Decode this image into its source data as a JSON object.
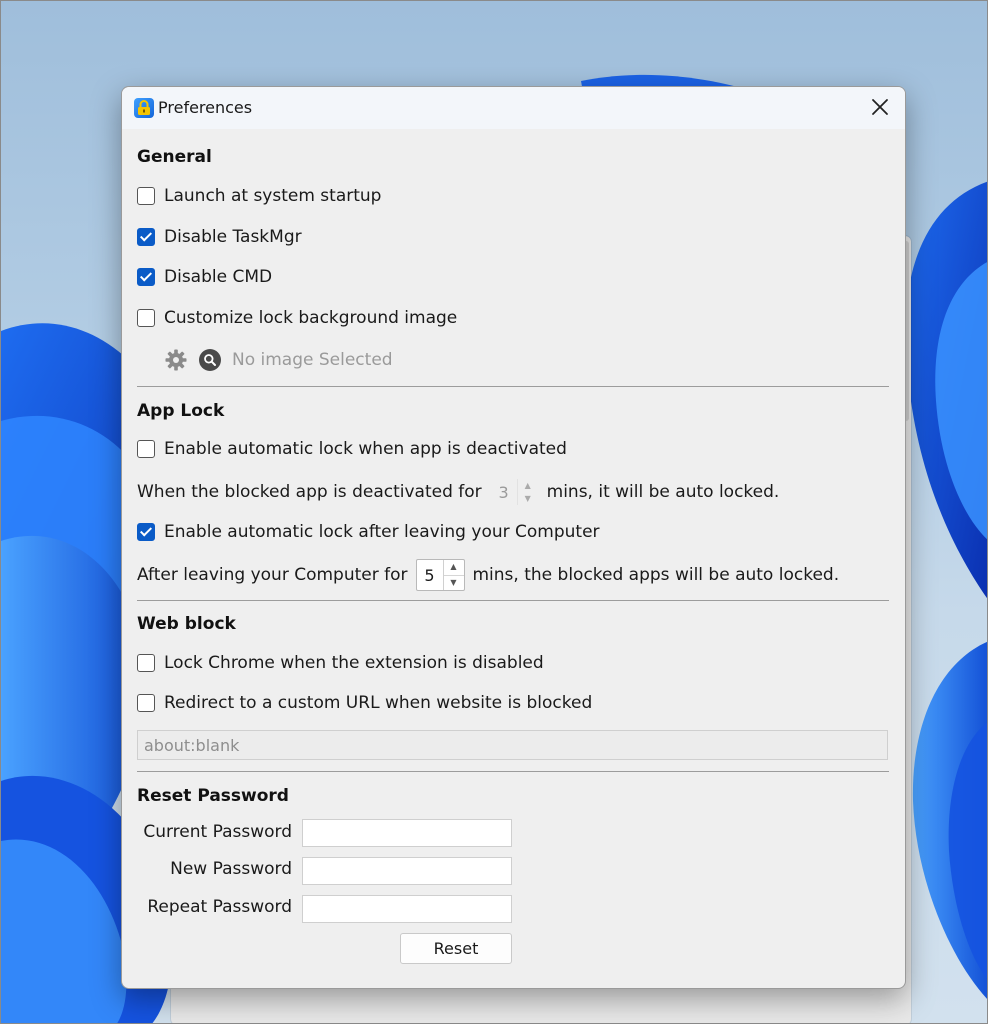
{
  "window": {
    "title": "Preferences",
    "app_icon": "lock-icon",
    "close_icon": "close-icon"
  },
  "general": {
    "title": "General",
    "launch_startup": {
      "label": "Launch at system startup",
      "checked": false
    },
    "disable_taskmgr": {
      "label": "Disable TaskMgr",
      "checked": true
    },
    "disable_cmd": {
      "label": "Disable CMD",
      "checked": true
    },
    "customize_bg": {
      "label": "Customize lock background image",
      "checked": false
    },
    "image_status": "No image Selected",
    "settings_icon": "gear-icon",
    "browse_icon": "search-icon"
  },
  "app_lock": {
    "title": "App Lock",
    "auto_lock_deactivated": {
      "label": "Enable automatic lock when app is deactivated",
      "checked": false
    },
    "deactivated_prefix": "When the blocked app is deactivated for",
    "deactivated_value": "3",
    "deactivated_suffix": "mins, it will be auto locked.",
    "auto_lock_leaving": {
      "label": "Enable automatic lock after leaving your Computer",
      "checked": true
    },
    "leaving_prefix": "After leaving your Computer for",
    "leaving_value": "5",
    "leaving_suffix": "mins, the blocked apps will be auto locked."
  },
  "web_block": {
    "title": "Web block",
    "lock_chrome": {
      "label": "Lock Chrome when the extension is disabled",
      "checked": false
    },
    "redirect": {
      "label": "Redirect to a custom URL when website is blocked",
      "checked": false
    },
    "url_value": "about:blank"
  },
  "reset_password": {
    "title": "Reset Password",
    "current_label": "Current Password",
    "new_label": "New Password",
    "repeat_label": "Repeat Password",
    "reset_button": "Reset"
  },
  "colors": {
    "accent": "#0a5bc7",
    "dialog_bg": "#efefef",
    "titlebar_bg": "#f3f6fa"
  }
}
